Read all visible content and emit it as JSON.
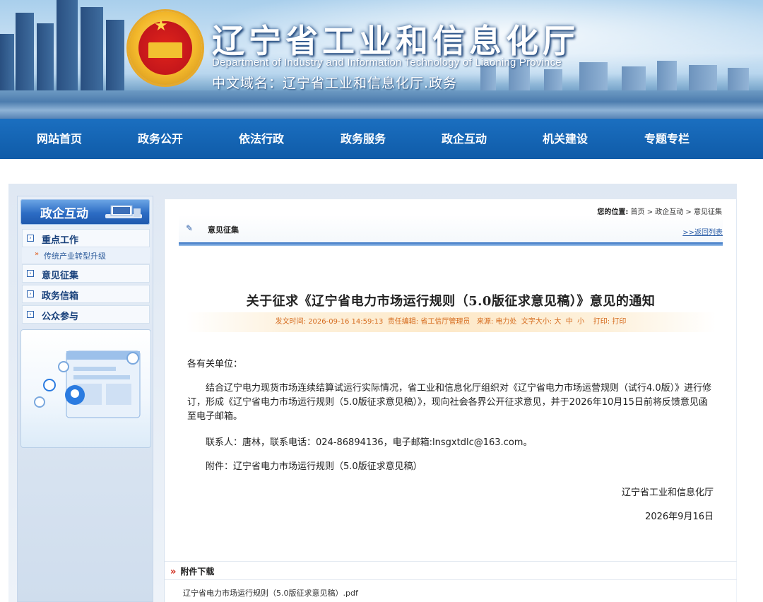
{
  "header": {
    "title": "辽宁省工业和信息化厅",
    "subtitle_en": "Department of Industry and Information Technology of Liaoning Province",
    "domain": "中文域名：辽宁省工业和信息化厅.政务"
  },
  "nav": {
    "items": [
      {
        "label": "网站首页"
      },
      {
        "label": "政务公开"
      },
      {
        "label": "依法行政"
      },
      {
        "label": "政务服务"
      },
      {
        "label": "政企互动"
      },
      {
        "label": "机关建设"
      },
      {
        "label": "专题专栏"
      }
    ]
  },
  "sidebar": {
    "title": "政企互动",
    "items": [
      {
        "label": "重点工作"
      },
      {
        "label": "意见征集"
      },
      {
        "label": "政务信箱"
      },
      {
        "label": "公众参与"
      }
    ],
    "sub_items": [
      {
        "label": "传统产业转型升级"
      }
    ]
  },
  "breadcrumb": {
    "prefix": "您的位置:",
    "path": "首页 > 政企互动 > 意见征集"
  },
  "section": {
    "label": "意见征集",
    "back_link": ">>返回列表"
  },
  "article": {
    "title": "关于征求《辽宁省电力市场运行规则（5.0版征求意见稿）》意见的通知",
    "meta_time": "发文时间: 2026-09-16 14:59:13",
    "meta_editor": "责任编辑: 省工信厅管理员",
    "meta_source": "来源: 电力处",
    "meta_fontsize_label": "文字大小:",
    "meta_font_large": "大",
    "meta_font_medium": "中",
    "meta_font_small": "小",
    "meta_print_label": "打印:",
    "meta_print": "打印",
    "salutation": "各有关单位：",
    "body": "结合辽宁电力现货市场连续结算试运行实际情况，省工业和信息化厅组织对《辽宁省电力市场运营规则（试行4.0版）》进行修订，形成《辽宁省电力市场运行规则（5.0版征求意见稿）》，现向社会各界公开征求意见，并于2026年10月15日前将反馈意见函至电子邮箱。",
    "contact": "联系人：唐林，联系电话：024-86894136，电子邮箱:lnsgxtdlc@163.com。",
    "attachment_note": "附件：辽宁省电力市场运行规则（5.0版征求意见稿）",
    "signature": "辽宁省工业和信息化厅",
    "date": "2026年9月16日"
  },
  "attachments": {
    "heading": "附件下载",
    "chevron": "»",
    "files": [
      {
        "name": "辽宁省电力市场运行规则（5.0版征求意见稿）.pdf"
      }
    ]
  },
  "colors": {
    "nav_bg": "#0f5ba8",
    "meta_text": "#d56a1c",
    "sidebar_head": "#2c6cc4"
  }
}
